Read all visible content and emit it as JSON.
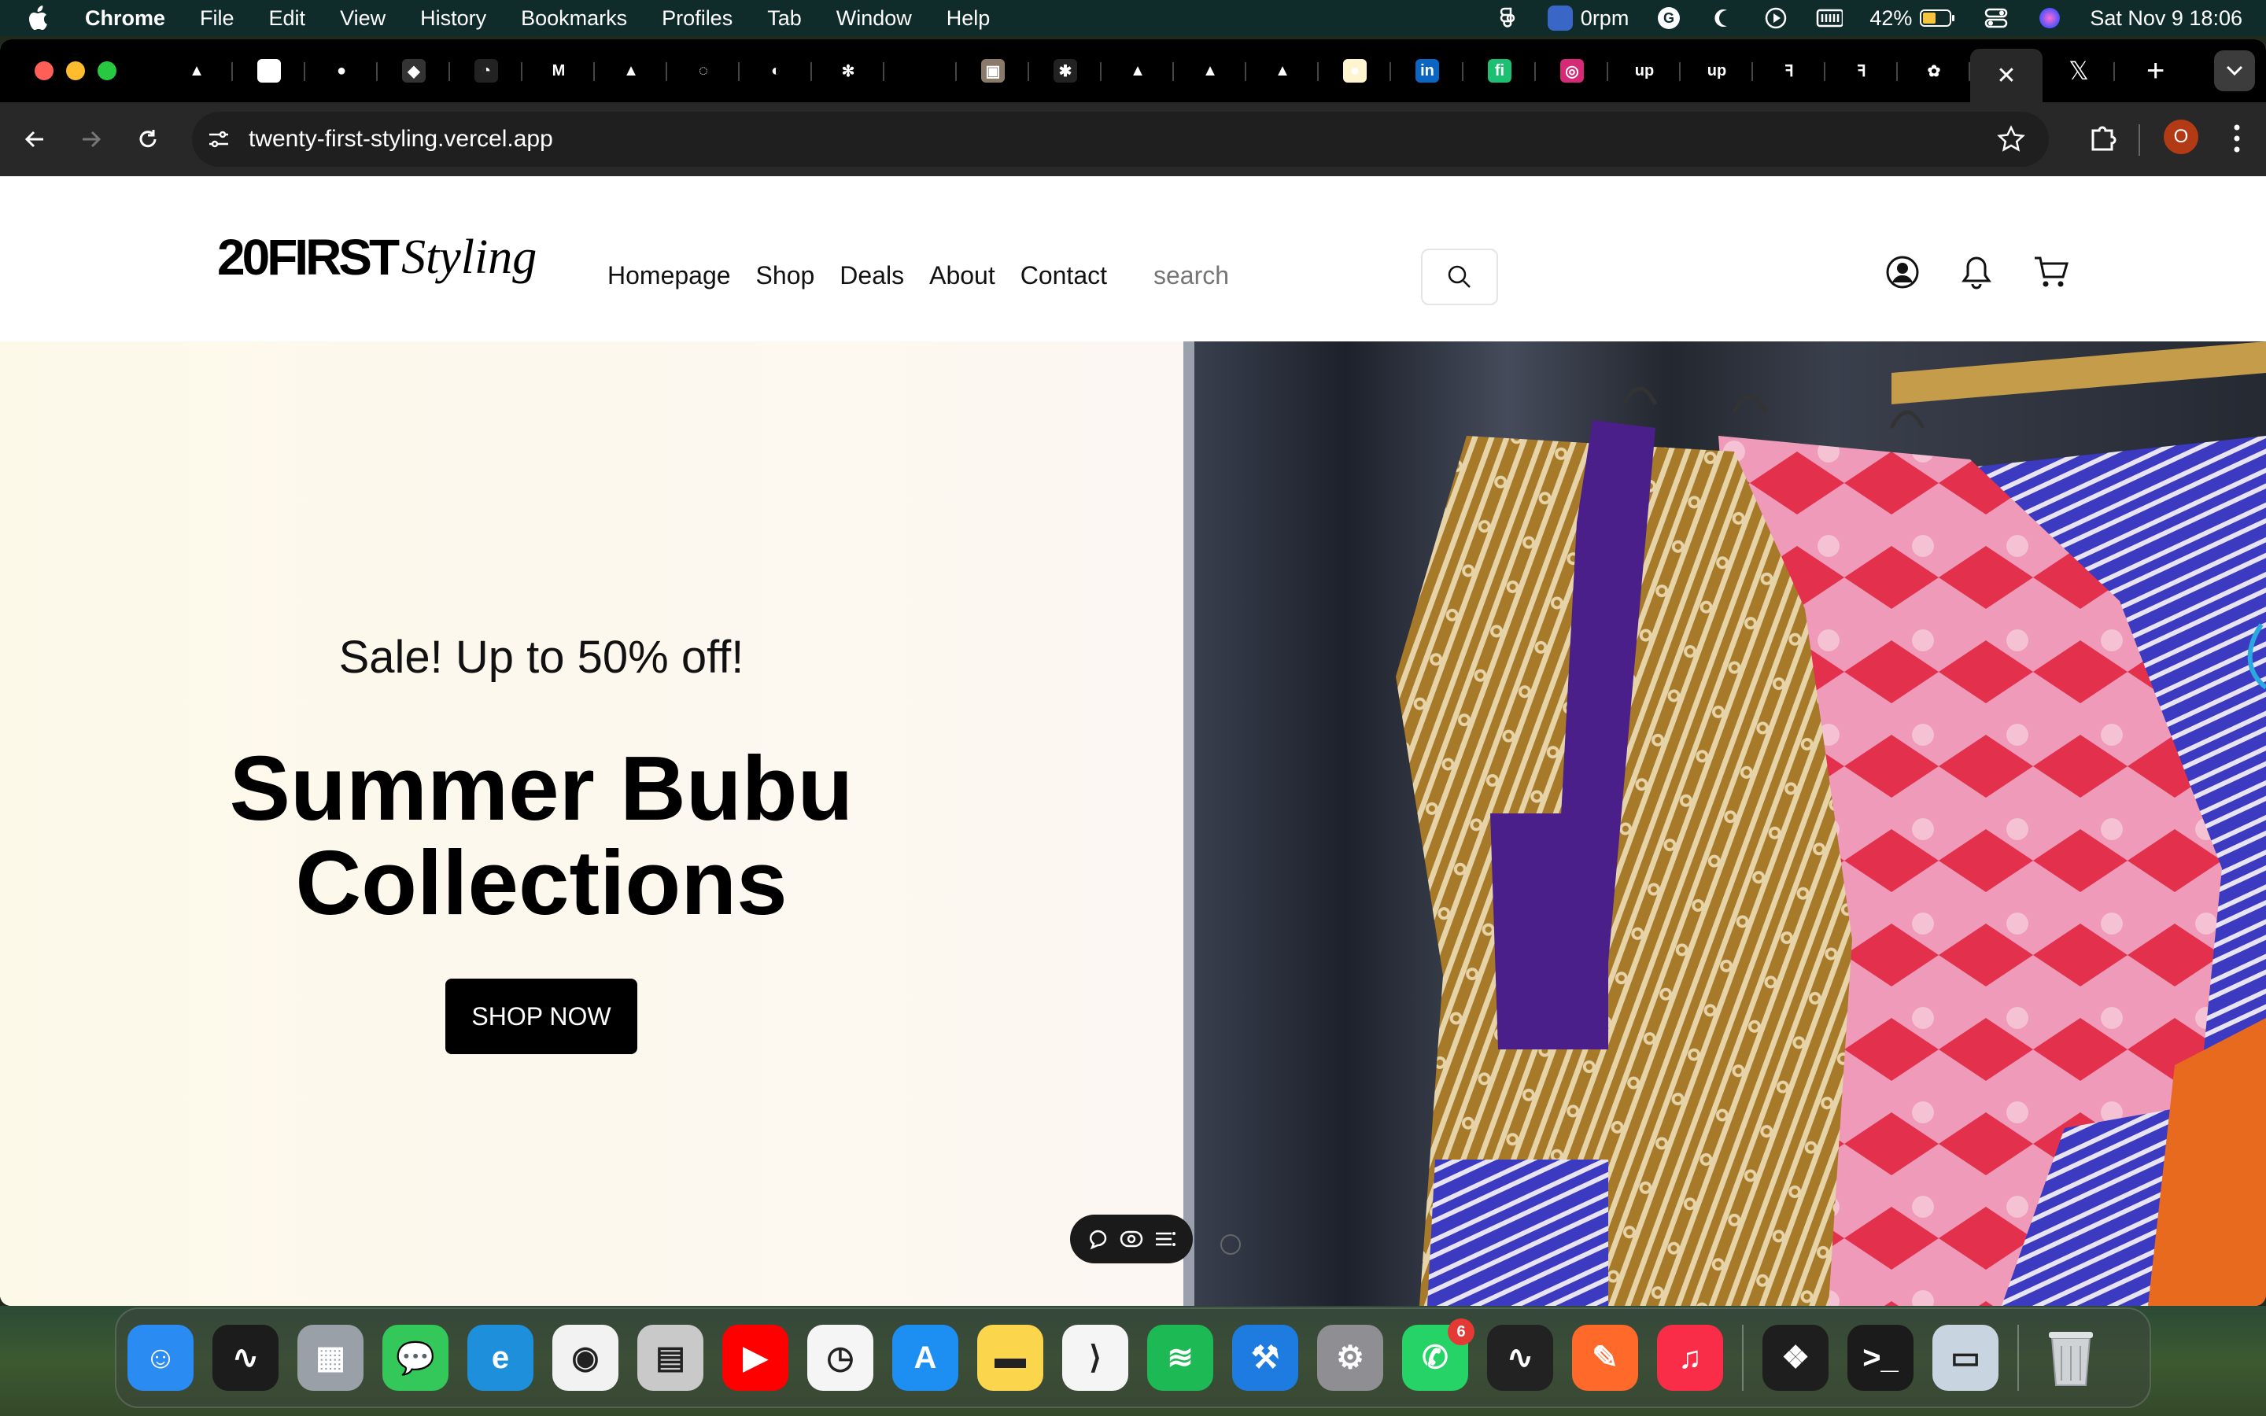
{
  "menubar": {
    "app_name": "Chrome",
    "menus": [
      "File",
      "Edit",
      "View",
      "History",
      "Bookmarks",
      "Profiles",
      "Tab",
      "Window",
      "Help"
    ],
    "fan_speed": "0rpm",
    "battery": "42%",
    "datetime": "Sat Nov 9  18:06"
  },
  "browser": {
    "url": "twenty-first-styling.vercel.app",
    "profile_initial": "O",
    "tabs": [
      {
        "icon": "vercel-icon",
        "glyph": "▲",
        "color": "#000"
      },
      {
        "icon": "page-icon",
        "glyph": "✎",
        "color": "#fff"
      },
      {
        "icon": "github-icon",
        "glyph": "●",
        "color": "#000"
      },
      {
        "icon": "app-icon",
        "glyph": "◆",
        "color": "#333"
      },
      {
        "icon": "gauge-icon",
        "glyph": "◔",
        "color": "#222"
      },
      {
        "icon": "gmail-icon",
        "glyph": "M",
        "color": "#000"
      },
      {
        "icon": "vercel-icon",
        "glyph": "▲",
        "color": "#000"
      },
      {
        "icon": "loader-icon",
        "glyph": "◌",
        "color": "#000"
      },
      {
        "icon": "digitalocean-icon",
        "glyph": "◐",
        "color": "#000"
      },
      {
        "icon": "openai-icon",
        "glyph": "✻",
        "color": "#000"
      },
      {
        "icon": "blank-icon",
        "glyph": "",
        "color": "#000"
      },
      {
        "icon": "photo-icon",
        "glyph": "▣",
        "color": "#8a7a6a"
      },
      {
        "icon": "colorful-icon",
        "glyph": "✱",
        "color": "#222"
      },
      {
        "icon": "vercel-icon",
        "glyph": "▲",
        "color": "#000"
      },
      {
        "icon": "vercel-icon",
        "glyph": "▲",
        "color": "#000"
      },
      {
        "icon": "vercel-icon",
        "glyph": "▲",
        "color": "#000"
      },
      {
        "icon": "sun-icon",
        "glyph": "●",
        "color": "#fff4d0"
      },
      {
        "icon": "linkedin-icon",
        "glyph": "in",
        "color": "#0a66c2"
      },
      {
        "icon": "fiverr-icon",
        "glyph": "fi",
        "color": "#1dbf73"
      },
      {
        "icon": "instagram-icon",
        "glyph": "◎",
        "color": "#d62976"
      },
      {
        "icon": "upwork-icon",
        "glyph": "up",
        "color": "#000"
      },
      {
        "icon": "upwork-icon",
        "glyph": "up",
        "color": "#000"
      },
      {
        "icon": "site-icon",
        "glyph": "ꟻ",
        "color": "#000"
      },
      {
        "icon": "site-icon",
        "glyph": "ꟻ",
        "color": "#000"
      },
      {
        "icon": "google-photos-icon",
        "glyph": "✿",
        "color": "#000"
      }
    ]
  },
  "site": {
    "logo_block": "20FIRST",
    "logo_script": "Styling",
    "nav": [
      "Homepage",
      "Shop",
      "Deals",
      "About",
      "Contact"
    ],
    "search_placeholder": "search"
  },
  "hero": {
    "sale_text": "Sale! Up to 50% off!",
    "title_line1": "Summer Bubu",
    "title_line2": "Collections",
    "cta_label": "SHOP NOW"
  },
  "dock": {
    "apps": [
      {
        "name": "finder",
        "glyph": "☺",
        "bg": "#2a8bf2"
      },
      {
        "name": "voice-memos",
        "glyph": "∿",
        "bg": "#1c1c1c"
      },
      {
        "name": "launchpad",
        "glyph": "▦",
        "bg": "#9aa0a8"
      },
      {
        "name": "messages",
        "glyph": "💬",
        "bg": "#34c759"
      },
      {
        "name": "edge",
        "glyph": "e",
        "bg": "#1d8fdb"
      },
      {
        "name": "chrome",
        "glyph": "◉",
        "bg": "#f2f2f2"
      },
      {
        "name": "calculator",
        "glyph": "▤",
        "bg": "#c9c9c9"
      },
      {
        "name": "youtube-music",
        "glyph": "▶",
        "bg": "#ff0000"
      },
      {
        "name": "clock",
        "glyph": "◷",
        "bg": "#f5f5f5"
      },
      {
        "name": "app-store",
        "glyph": "A",
        "bg": "#1d8ff2"
      },
      {
        "name": "notes",
        "glyph": "▬",
        "bg": "#fbd54b"
      },
      {
        "name": "vscode",
        "glyph": "⟩",
        "bg": "#f5f5f5"
      },
      {
        "name": "spotify",
        "glyph": "≋",
        "bg": "#1db954"
      },
      {
        "name": "xcode",
        "glyph": "⚒",
        "bg": "#1e7ce0"
      },
      {
        "name": "system-settings",
        "glyph": "⚙",
        "bg": "#8e8e93"
      },
      {
        "name": "whatsapp",
        "glyph": "✆",
        "bg": "#25d366",
        "badge": "6"
      },
      {
        "name": "activity-monitor",
        "glyph": "∿",
        "bg": "#222"
      },
      {
        "name": "pen-app",
        "glyph": "✎",
        "bg": "#ff6a2b"
      },
      {
        "name": "music",
        "glyph": "♫",
        "bg": "#fa2d48"
      }
    ],
    "apps_right": [
      {
        "name": "figma",
        "glyph": "❖",
        "bg": "#1e1e1e"
      },
      {
        "name": "terminal",
        "glyph": ">_",
        "bg": "#1b1b1b"
      },
      {
        "name": "preview",
        "glyph": "▭",
        "bg": "#c8d4e0"
      }
    ],
    "trash": {
      "name": "trash",
      "glyph": "🗑",
      "bg": "transparent"
    }
  },
  "colors": {
    "menubar_bg": "#0f2b2a",
    "tabstrip_bg": "#000000",
    "toolbar_bg": "#282828",
    "hero_cream": "#fdf9e9",
    "cta_bg": "#000000"
  }
}
